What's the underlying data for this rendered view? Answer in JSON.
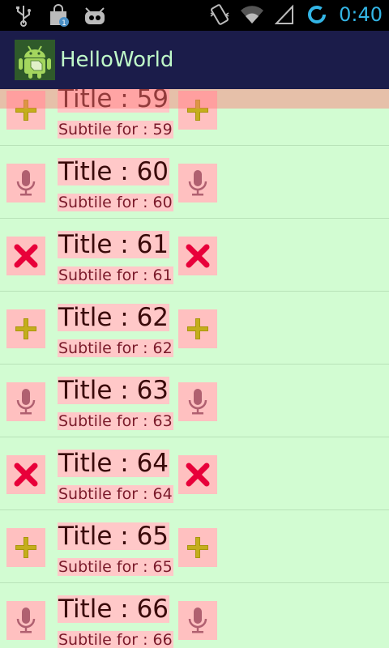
{
  "status_bar": {
    "icons_left": [
      "usb-icon",
      "shopping-bag-icon",
      "cyanogen-mascot-icon"
    ],
    "icons_right": [
      "vibrate-icon",
      "wifi-icon",
      "signal-icon",
      "sync-icon"
    ],
    "time": "0:40",
    "time_color": "#33b5e5"
  },
  "action_bar": {
    "title": "HelloWorld",
    "icon": "android-app-icon",
    "background": "#1b1c4a"
  },
  "list": {
    "background": "#d2fcd2",
    "item_highlight": "#ffc0c0",
    "items": [
      {
        "title": "Title : 59",
        "subtitle": "Subtile for : 59",
        "icon": "plus-icon"
      },
      {
        "title": "Title : 60",
        "subtitle": "Subtile for : 60",
        "icon": "microphone-icon"
      },
      {
        "title": "Title : 61",
        "subtitle": "Subtile for : 61",
        "icon": "close-icon"
      },
      {
        "title": "Title : 62",
        "subtitle": "Subtile for : 62",
        "icon": "plus-icon"
      },
      {
        "title": "Title : 63",
        "subtitle": "Subtile for : 63",
        "icon": "microphone-icon"
      },
      {
        "title": "Title : 64",
        "subtitle": "Subtile for : 64",
        "icon": "close-icon"
      },
      {
        "title": "Title : 65",
        "subtitle": "Subtile for : 65",
        "icon": "plus-icon"
      },
      {
        "title": "Title : 66",
        "subtitle": "Subtile for : 66",
        "icon": "microphone-icon"
      }
    ]
  }
}
